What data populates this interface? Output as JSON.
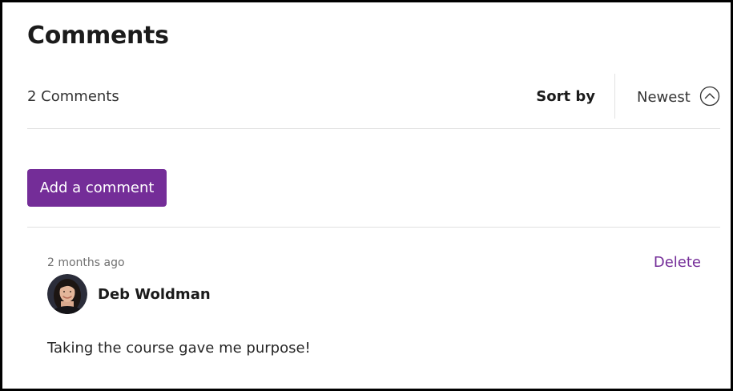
{
  "header": {
    "title": "Comments",
    "count_text": "2 Comments"
  },
  "sort": {
    "label": "Sort by",
    "selected": "Newest",
    "icon": "chevron-up-circle-icon"
  },
  "actions": {
    "add_comment_label": "Add a comment"
  },
  "comments": [
    {
      "timestamp": "2 months ago",
      "author": "Deb Woldman",
      "avatar": "avatar-photo",
      "text": "Taking the course gave me purpose!",
      "delete_label": "Delete"
    }
  ],
  "colors": {
    "accent": "#742d98",
    "text_primary": "#1b1b1b",
    "text_secondary": "#707070",
    "divider": "#e1e1e1",
    "frame_border": "#000000"
  }
}
